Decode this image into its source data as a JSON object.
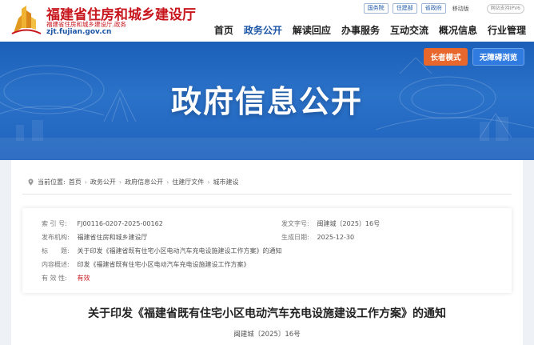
{
  "header": {
    "site_title": "福建省住房和城乡建设厅",
    "site_subtitle": "福建省住房和城乡建设厅.政务",
    "site_url": "zjt.fujian.gov.cn",
    "top_links": [
      "国务院",
      "住建部",
      "省政府"
    ],
    "mobile_label": "移动版",
    "ipv6_label": "网站支持IPV6"
  },
  "nav": {
    "items": [
      "首页",
      "政务公开",
      "解读回应",
      "办事服务",
      "互动交流",
      "概况信息",
      "行业管理"
    ],
    "active_index": 1
  },
  "banner": {
    "title": "政府信息公开",
    "elder_mode_label": "长者模式",
    "accessible_label": "无障碍浏览"
  },
  "breadcrumb": {
    "prefix": "当前位置:",
    "items": [
      "首页",
      "政务公开",
      "政府信息公开",
      "住建厅文件",
      "城市建设"
    ]
  },
  "meta": {
    "index_label": "索 引 号:",
    "index_value": "FJ00116-0207-2025-00162",
    "doc_no_label": "发文字号:",
    "doc_no_value": "闽建城〔2025〕16号",
    "issuer_label": "发布机构:",
    "issuer_value": "福建省住房和城乡建设厅",
    "date_label": "生成日期:",
    "date_value": "2025-12-30",
    "title_label": "标　　题:",
    "title_value": "关于印发《福建省既有住宅小区电动汽车充电设施建设工作方案》的通知",
    "summary_label": "内容概述:",
    "summary_value": "印发《福建省既有住宅小区电动汽车充电设施建设工作方案》",
    "validity_label": "有 效 性:",
    "validity_value": "有效"
  },
  "document": {
    "title": "关于印发《福建省既有住宅小区电动汽车充电设施建设工作方案》的通知",
    "number": "闽建城〔2025〕16号"
  },
  "colors": {
    "brand_red": "#c8161d",
    "brand_blue": "#1d55a6",
    "elder_orange": "#e8672c",
    "access_blue": "#2f7be0"
  }
}
